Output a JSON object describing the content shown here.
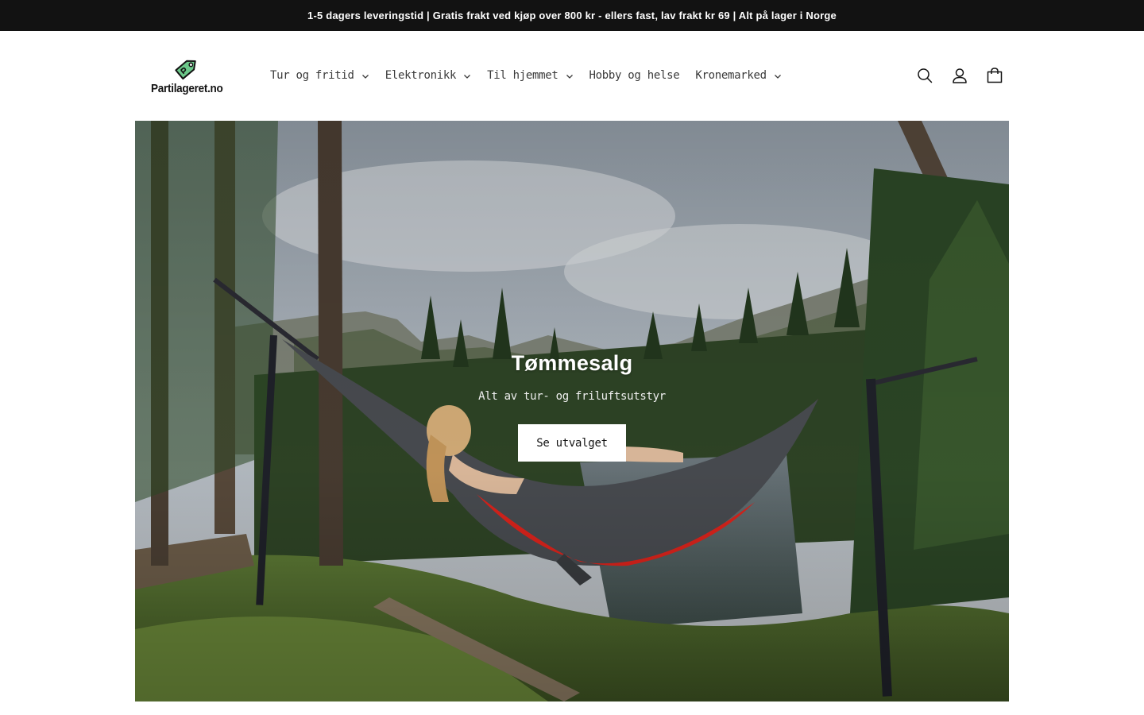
{
  "announcement": {
    "text": "1-5 dagers leveringstid | Gratis frakt ved kjøp over 800 kr - ellers fast, lav frakt kr 69 | Alt på lager i Norge"
  },
  "header": {
    "logo_text": "Partilageret.no",
    "nav": [
      {
        "label": "Tur og fritid",
        "has_dropdown": true
      },
      {
        "label": "Elektronikk",
        "has_dropdown": true
      },
      {
        "label": "Til hjemmet",
        "has_dropdown": true
      },
      {
        "label": "Hobby og helse",
        "has_dropdown": false
      },
      {
        "label": "Kronemarked",
        "has_dropdown": true
      }
    ],
    "icons": [
      "search-icon",
      "account-icon",
      "cart-icon"
    ]
  },
  "hero": {
    "title": "Tømmesalg",
    "subtitle": "Alt av tur- og friluftsutstyr",
    "button_label": "Se utvalget"
  },
  "colors": {
    "announcement_bg": "#121212",
    "logo_green": "#5bbd7a",
    "hammock_red": "#e0241c",
    "hammock_grey": "#4a4d52"
  }
}
